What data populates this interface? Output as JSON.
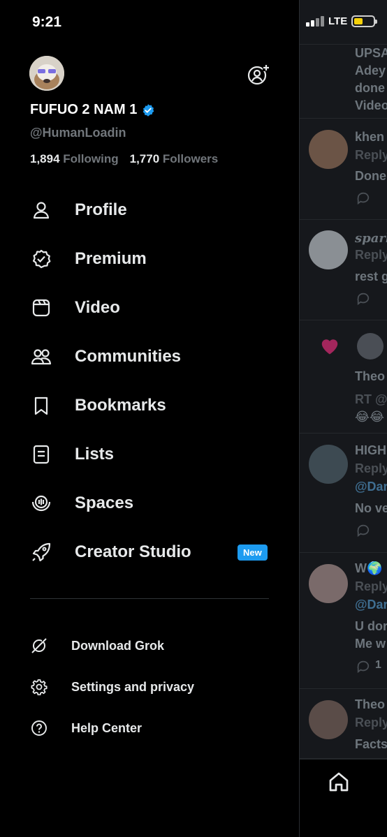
{
  "status_bar": {
    "time": "9:21",
    "network": "LTE",
    "battery_color": "#f5d10a"
  },
  "profile": {
    "display_name": "FUFUO 2 NAM 1",
    "handle": "@HumanLoadin",
    "following_count": "1,894",
    "following_label": "Following",
    "followers_count": "1,770",
    "followers_label": "Followers",
    "verified_color": "#1d9bf0"
  },
  "menu": [
    {
      "label": "Profile",
      "icon": "person-icon"
    },
    {
      "label": "Premium",
      "icon": "premium-badge-icon"
    },
    {
      "label": "Video",
      "icon": "video-icon"
    },
    {
      "label": "Communities",
      "icon": "communities-icon"
    },
    {
      "label": "Bookmarks",
      "icon": "bookmark-icon"
    },
    {
      "label": "Lists",
      "icon": "list-icon"
    },
    {
      "label": "Spaces",
      "icon": "spaces-icon"
    },
    {
      "label": "Creator Studio",
      "icon": "rocket-icon",
      "badge": "New"
    }
  ],
  "secondary_menu": [
    {
      "label": "Download Grok",
      "icon": "grok-icon"
    },
    {
      "label": "Settings and privacy",
      "icon": "gear-icon"
    },
    {
      "label": "Help Center",
      "icon": "help-icon"
    }
  ],
  "feed_preview": {
    "items": [
      {
        "lines": [
          "UPSA",
          "Adey",
          "done",
          "Video"
        ]
      },
      {
        "lines": [
          "khen",
          "Reply",
          "Done"
        ]
      },
      {
        "lines": [
          "spark",
          "Reply",
          "rest g"
        ]
      },
      {
        "lines": [
          "Theo",
          "RT @",
          "😂😂"
        ]
      },
      {
        "lines": [
          "HIGH",
          "Reply",
          "@Dar",
          "No ve"
        ]
      },
      {
        "lines": [
          "W🌍",
          "Reply",
          "@Dar",
          "U dor",
          "Me w"
        ],
        "reply_count": "1"
      },
      {
        "lines": [
          "Theo",
          "Reply",
          "Facts"
        ]
      }
    ]
  }
}
